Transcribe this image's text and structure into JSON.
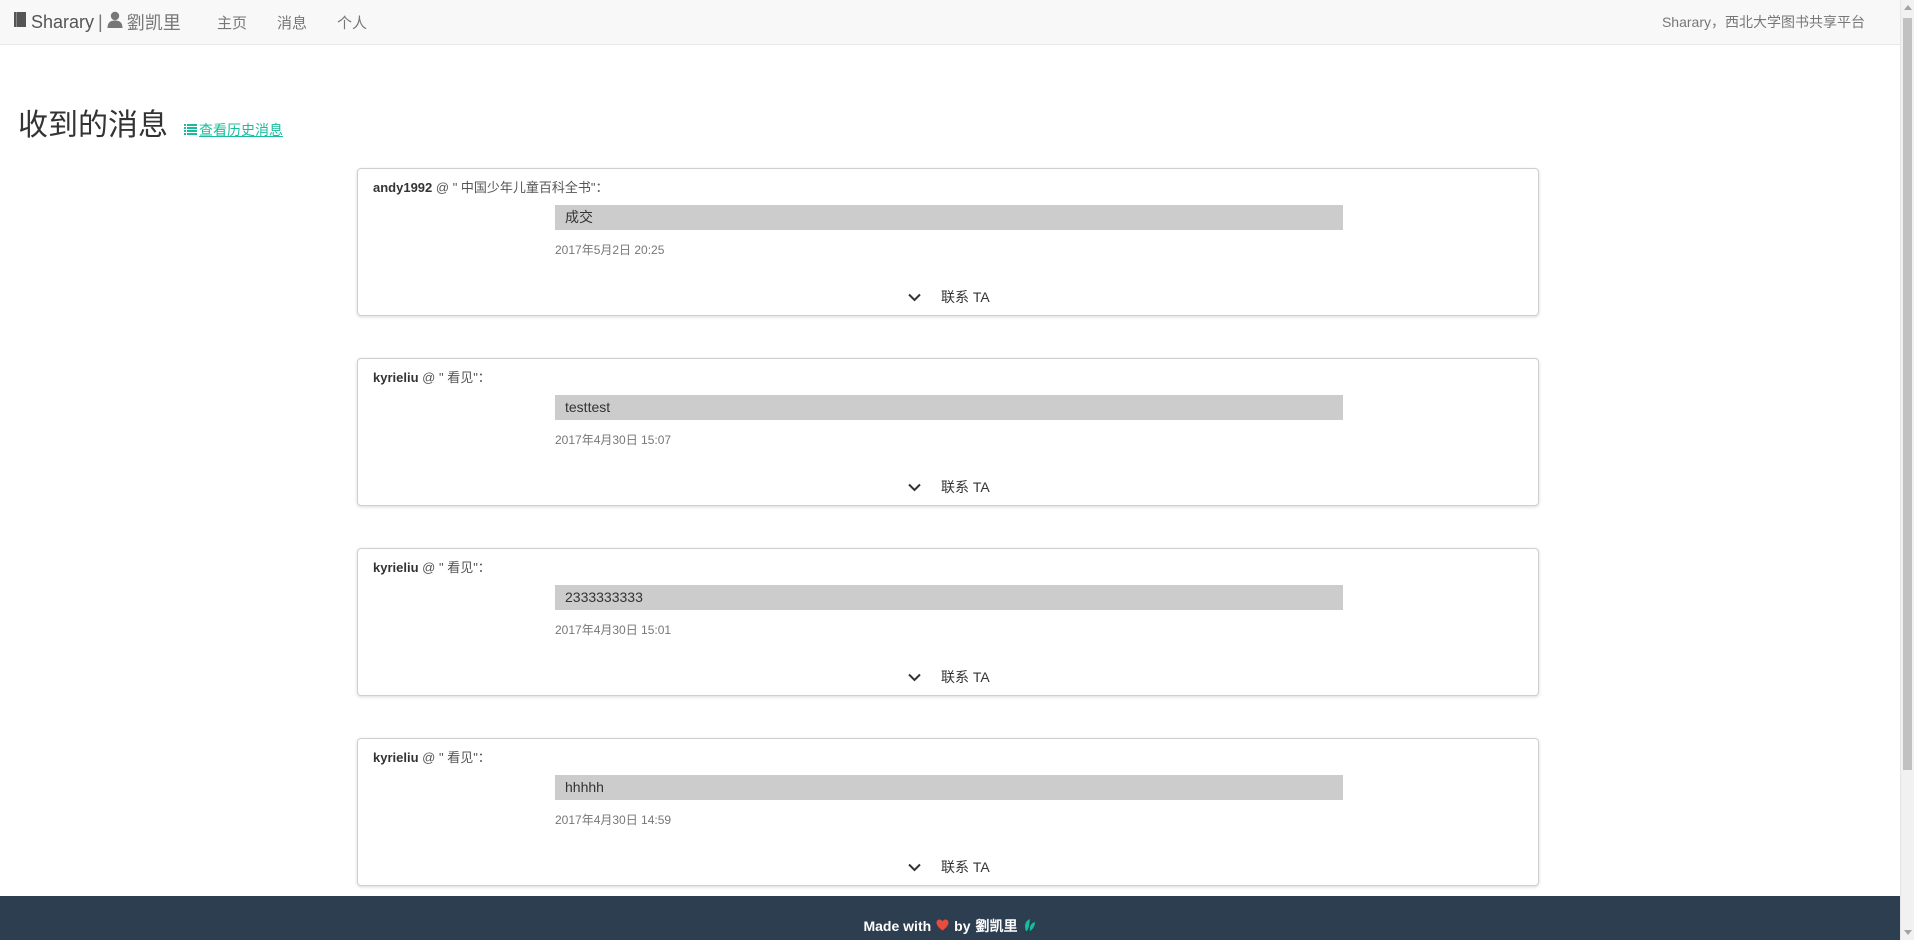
{
  "navbar": {
    "brand": "Sharary",
    "separator": "|",
    "user": "劉凯里",
    "links": [
      "主页",
      "消息",
      "个人"
    ],
    "right_text": "Sharary，西北大学图书共享平台"
  },
  "header": {
    "title": "收到的消息",
    "history_link": "查看历史消息"
  },
  "messages": [
    {
      "user": "andy1992",
      "at": "@ \" 中国少年儿童百科全书\"：",
      "text": "成交",
      "time": "2017年5月2日 20:25",
      "contact": "联系 TA"
    },
    {
      "user": "kyrieliu",
      "at": "@ \" 看见\"：",
      "text": "testtest",
      "time": "2017年4月30日 15:07",
      "contact": "联系 TA"
    },
    {
      "user": "kyrieliu",
      "at": "@ \" 看见\"：",
      "text": "2333333333",
      "time": "2017年4月30日 15:01",
      "contact": "联系 TA"
    },
    {
      "user": "kyrieliu",
      "at": "@ \" 看见\"：",
      "text": "hhhhh",
      "time": "2017年4月30日 14:59",
      "contact": "联系 TA"
    }
  ],
  "footer": {
    "made_with": "Made with",
    "by": "by",
    "author": "劉凯里"
  },
  "colors": {
    "accent": "#18bc9c",
    "footer_bg": "#2c3e50",
    "heart": "#e74c3c",
    "message_bg": "#cccccc"
  }
}
